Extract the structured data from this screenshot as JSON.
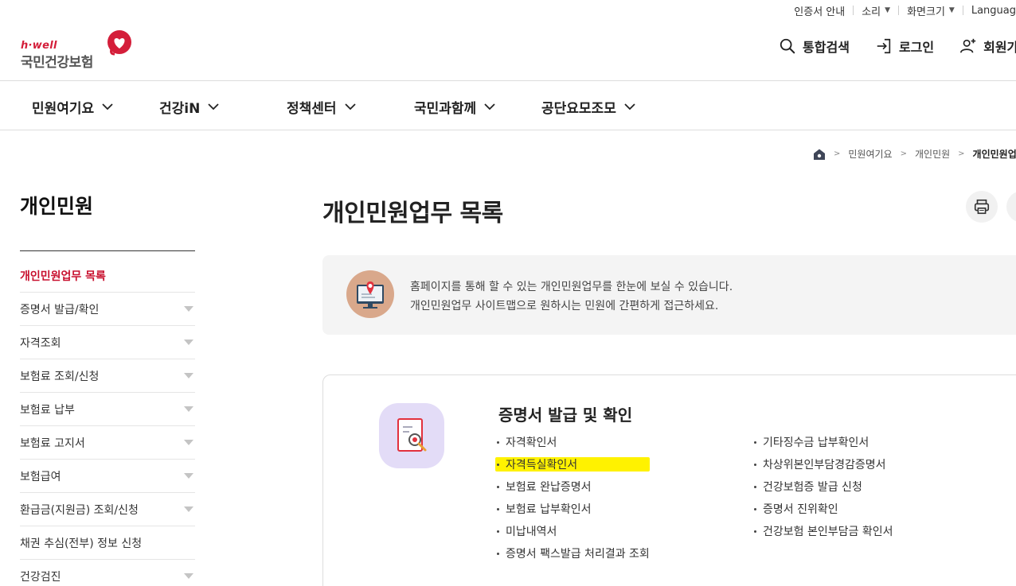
{
  "util": {
    "cert_guide": "인증서 안내",
    "sound": "소리",
    "screen_size": "화면크기",
    "language": "Languag"
  },
  "logo": {
    "sub": "h·well",
    "main": "국민건강보험"
  },
  "header": {
    "search": "통합검색",
    "login": "로그인",
    "signup": "회원가입"
  },
  "gnb": [
    "민원여기요",
    "건강iN",
    "정책센터",
    "국민과함께",
    "공단요모조모"
  ],
  "breadcrumb": {
    "level1": "민원여기요",
    "level2": "개인민원",
    "current": "개인민원업무"
  },
  "lnb": {
    "title": "개인민원",
    "items": [
      {
        "label": "개인민원업무 목록",
        "active": true,
        "expandable": false
      },
      {
        "label": "증명서 발급/확인",
        "active": false,
        "expandable": true
      },
      {
        "label": "자격조회",
        "active": false,
        "expandable": true
      },
      {
        "label": "보험료 조회/신청",
        "active": false,
        "expandable": true
      },
      {
        "label": "보험료 납부",
        "active": false,
        "expandable": true
      },
      {
        "label": "보험료 고지서",
        "active": false,
        "expandable": true
      },
      {
        "label": "보험급여",
        "active": false,
        "expandable": true
      },
      {
        "label": "환급금(지원금) 조회/신청",
        "active": false,
        "expandable": true
      },
      {
        "label": "채권 추심(전부) 정보 신청",
        "active": false,
        "expandable": false
      },
      {
        "label": "건강검진",
        "active": false,
        "expandable": true
      }
    ]
  },
  "page": {
    "title": "개인민원업무 목록"
  },
  "info": {
    "line1": "홈페이지를 통해 할 수 있는 개인민원업무를 한눈에 보실 수 있습니다.",
    "line2": "개인민원업무 사이트맵으로 원하시는 민원에 간편하게 접근하세요."
  },
  "card": {
    "title": "증명서 발급 및 확인",
    "col1": [
      {
        "label": "자격확인서",
        "highlight": false
      },
      {
        "label": "자격득실확인서",
        "highlight": true
      },
      {
        "label": "보험료 완납증명서",
        "highlight": false
      },
      {
        "label": "보험료 납부확인서",
        "highlight": false
      },
      {
        "label": "미납내역서",
        "highlight": false
      },
      {
        "label": "증명서 팩스발급 처리결과 조회",
        "highlight": false
      }
    ],
    "col2": [
      {
        "label": "기타징수금 납부확인서",
        "highlight": false
      },
      {
        "label": "차상위본인부담경감증명서",
        "highlight": false
      },
      {
        "label": "건강보험증 발급 신청",
        "highlight": false
      },
      {
        "label": "증명서 진위확인",
        "highlight": false
      },
      {
        "label": "건강보험 본인부담금 확인서",
        "highlight": false
      }
    ]
  },
  "colors": {
    "brand_red": "#c8102e",
    "highlight": "#fff200",
    "card_icon_bg": "#e3dcf7"
  }
}
